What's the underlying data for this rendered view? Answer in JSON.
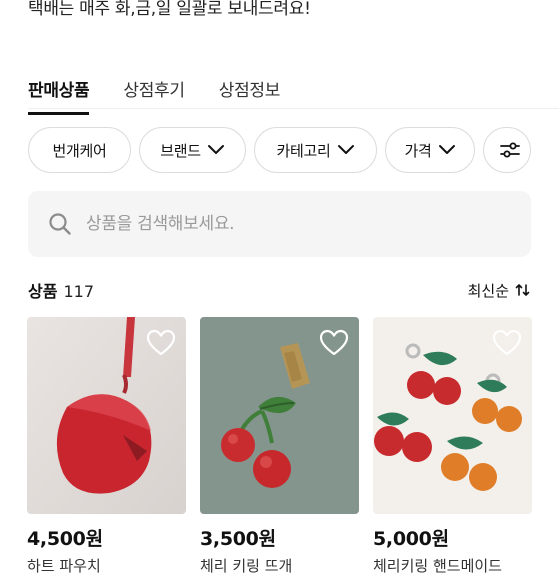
{
  "notice": "택배는 매주 화,금,일 일괄로 보내드려요!",
  "tabs": [
    {
      "label": "판매상품",
      "active": true
    },
    {
      "label": "상점후기",
      "active": false
    },
    {
      "label": "상점정보",
      "active": false
    }
  ],
  "filters": {
    "chip1": "번개케어",
    "chip2": "브랜드",
    "chip3": "카테고리",
    "chip4": "가격"
  },
  "search": {
    "placeholder": "상품을 검색해보세요."
  },
  "products_header": {
    "label": "상품",
    "count": "117",
    "sort_label": "최신순"
  },
  "products": [
    {
      "price": "4,500원",
      "name": "하트 파우치"
    },
    {
      "price": "3,500원",
      "name": "체리 키링 뜨개"
    },
    {
      "price": "5,000원",
      "name": "체리키링 핸드메이드"
    }
  ],
  "colors": {
    "accent": "#111111",
    "chip_border": "#dcdcdc",
    "search_bg": "#f5f5f5"
  }
}
